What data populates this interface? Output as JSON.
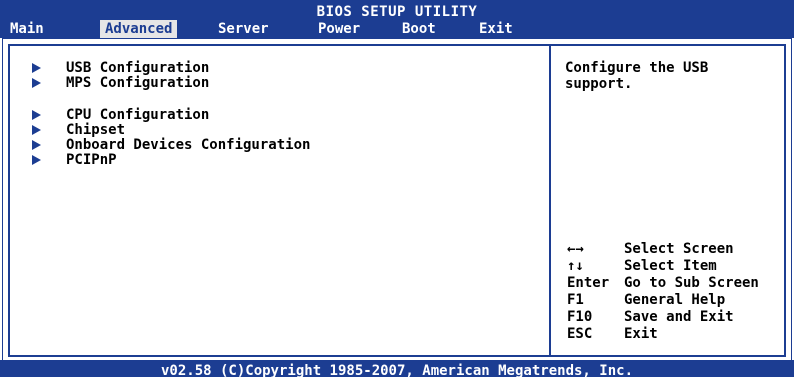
{
  "header": {
    "title": "BIOS SETUP UTILITY",
    "menu": [
      {
        "label": "Main"
      },
      {
        "label": "Advanced",
        "selected": true
      },
      {
        "label": "Server"
      },
      {
        "label": "Power"
      },
      {
        "label": "Boot"
      },
      {
        "label": "Exit"
      }
    ]
  },
  "main": {
    "items": [
      {
        "label": "USB Configuration",
        "icon": "triangle-right-icon"
      },
      {
        "label": "MPS Configuration",
        "icon": "triangle-right-icon"
      },
      {
        "label": "CPU Configuration",
        "icon": "triangle-right-icon"
      },
      {
        "label": "Chipset",
        "icon": "triangle-right-icon"
      },
      {
        "label": "Onboard Devices Configuration",
        "icon": "triangle-right-icon"
      },
      {
        "label": "PCIPnP",
        "icon": "triangle-right-icon"
      }
    ]
  },
  "help": {
    "text": "Configure the USB\nsupport."
  },
  "keys": [
    {
      "key": "←→",
      "desc": "Select Screen"
    },
    {
      "key": "↑↓",
      "desc": "Select Item"
    },
    {
      "key": "Enter",
      "desc": "Go to Sub Screen"
    },
    {
      "key": "F1",
      "desc": "General Help"
    },
    {
      "key": "F10",
      "desc": "Save and Exit"
    },
    {
      "key": "ESC",
      "desc": "Exit"
    }
  ],
  "footer": {
    "text": "v02.58 (C)Copyright 1985-2007, American Megatrends, Inc."
  },
  "colors": {
    "bar": "#1c3d92",
    "selected_bg": "#e6e6e6",
    "background": "#ffffff"
  }
}
